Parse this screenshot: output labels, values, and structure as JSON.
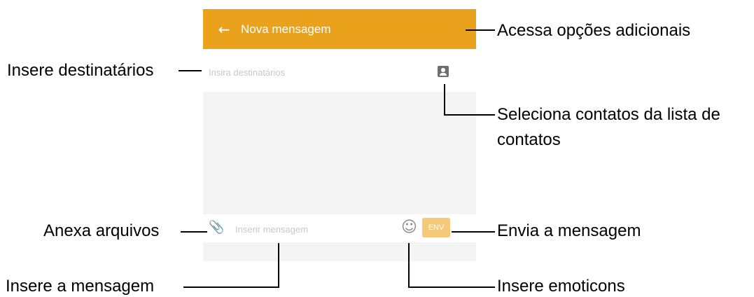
{
  "screen": {
    "title": "Nova mensagem",
    "back_icon": "arrow-left-icon",
    "recipient": {
      "placeholder": "Insira destinatários"
    },
    "contacts_icon": "contact-card-icon",
    "compose": {
      "attach_icon": "paperclip-icon",
      "placeholder": "Inserir mensagem",
      "emoticon_icon": "smiley-icon",
      "send_label": "ENV"
    },
    "colors": {
      "appbar": "#eaa21c",
      "send_button": "#f4c97a"
    }
  },
  "annotations": {
    "more_options": "Acessa opções adicionais",
    "recipients": "Insere destinatários",
    "contacts_line1": "Seleciona contatos da lista de",
    "contacts_line2": "contatos",
    "attach": "Anexa arquivos",
    "send": "Envia a mensagem",
    "message": "Insere a mensagem",
    "emoticons": "Insere emoticons"
  }
}
